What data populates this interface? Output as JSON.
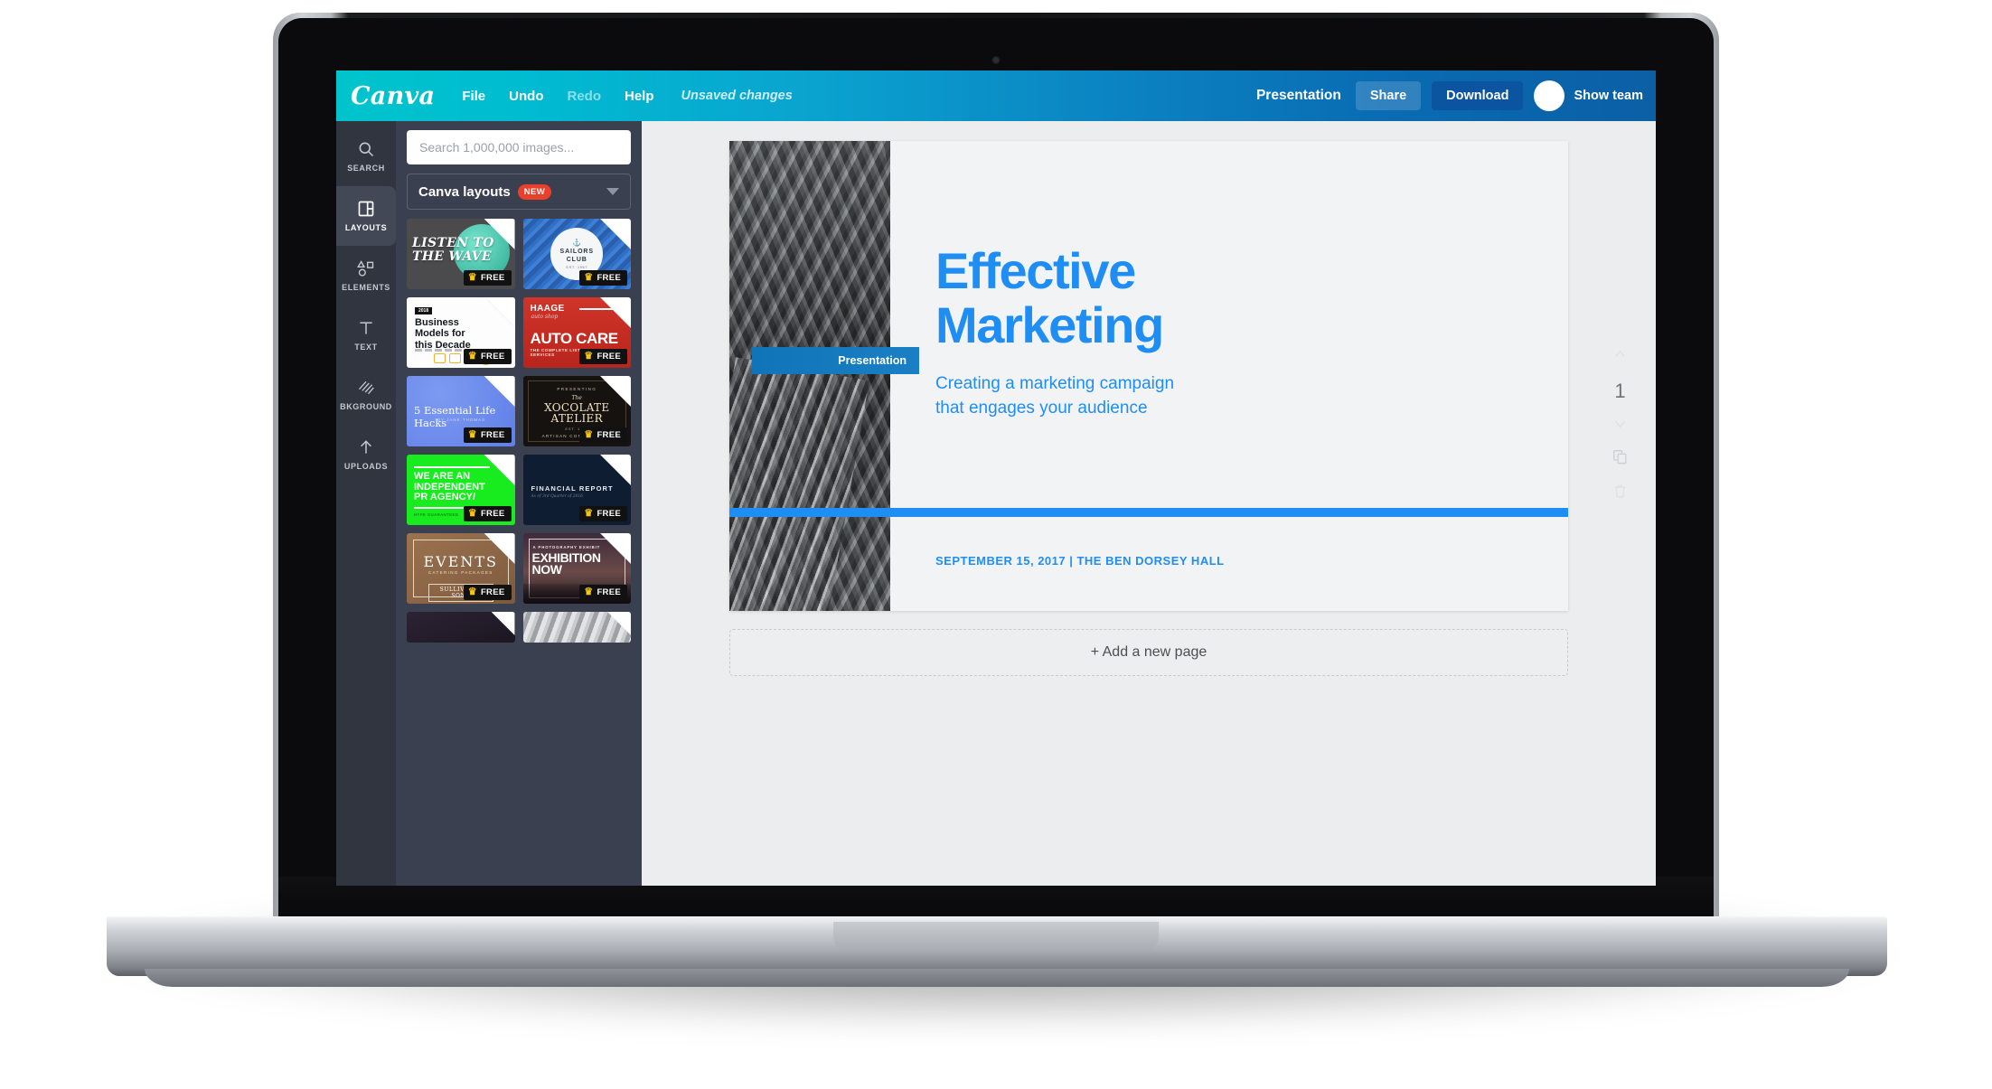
{
  "app": {
    "brand": "Canva",
    "menu": [
      {
        "label": "File",
        "dim": false
      },
      {
        "label": "Undo",
        "dim": false
      },
      {
        "label": "Redo",
        "dim": true
      },
      {
        "label": "Help",
        "dim": false
      }
    ],
    "status": "Unsaved changes",
    "doc_type": "Presentation",
    "share_label": "Share",
    "download_label": "Download",
    "team_label": "Show team",
    "accent_teal": "#00c4cc",
    "accent_blue": "#0b5fa5"
  },
  "rail": {
    "items": [
      {
        "label": "SEARCH",
        "icon": "search-icon",
        "active": false
      },
      {
        "label": "LAYOUTS",
        "icon": "layouts-icon",
        "active": true
      },
      {
        "label": "ELEMENTS",
        "icon": "elements-icon",
        "active": false
      },
      {
        "label": "TEXT",
        "icon": "text-icon",
        "active": false
      },
      {
        "label": "BKGROUND",
        "icon": "background-icon",
        "active": false
      },
      {
        "label": "UPLOADS",
        "icon": "upload-icon",
        "active": false
      }
    ]
  },
  "panel": {
    "search_placeholder": "Search 1,000,000 images...",
    "search_value": "",
    "dropdown_label": "Canva layouts",
    "dropdown_badge": "NEW",
    "free_label": "FREE",
    "templates": [
      {
        "name": "listen-to-the-wave",
        "title": "LISTEN TO THE WAVE",
        "free": true
      },
      {
        "name": "sailors-club",
        "title": "SAILORS CLUB",
        "subtitle": "EST. 1967",
        "free": true
      },
      {
        "name": "business-models",
        "title": "Business Models for this Decade",
        "tag": "2018",
        "free": true
      },
      {
        "name": "haage-auto-care",
        "title": "AUTO CARE",
        "brand": "HAAGE",
        "brand_sub": "auto shop",
        "subtitle": "THE COMPLETE LIST OF AVAILABLE SERVICES",
        "free": true
      },
      {
        "name": "life-hacks",
        "title": "5 Essential Life Hacks",
        "subtitle": "BY JANE THOMAS",
        "free": true
      },
      {
        "name": "xocolate-atelier",
        "title": "XOCOLATE ATELIER",
        "kicker": "PRESENTING",
        "pre": "The",
        "subtitle": "ARTISAN CONFECTIONS",
        "est": "EST. 1964",
        "free": true
      },
      {
        "name": "pr-agency",
        "title": "WE ARE AN INDEPENDENT PR AGENCY/",
        "subtitle": "HYPE GUARANTEED",
        "free": true
      },
      {
        "name": "financial-report",
        "title": "FINANCIAL REPORT",
        "subtitle": "As of 3rd Quarter of 2016",
        "free": true
      },
      {
        "name": "events-catering",
        "title": "EVENTS",
        "subtitle": "CATERING PACKAGES",
        "footer": "SULLIVAN & SONS",
        "free": true
      },
      {
        "name": "exhibition-now",
        "title": "EXHIBITION NOW",
        "kicker": "A PHOTOGRAPHY EXHIBIT",
        "free": true
      },
      {
        "name": "night-sky-report",
        "title": "",
        "free": false
      },
      {
        "name": "mountain-clouds",
        "title": "",
        "free": false
      }
    ]
  },
  "slide": {
    "badge": "Presentation",
    "title_line1": "Effective",
    "title_line2": "Marketing",
    "subtitle_line1": "Creating a marketing campaign",
    "subtitle_line2": "that engages your audience",
    "meta": "SEPTEMBER 15, 2017  |  THE BEN DORSEY HALL",
    "accent": "#1e8ef5"
  },
  "canvas": {
    "add_page_label": "+ Add a new page",
    "page_number": "1"
  }
}
